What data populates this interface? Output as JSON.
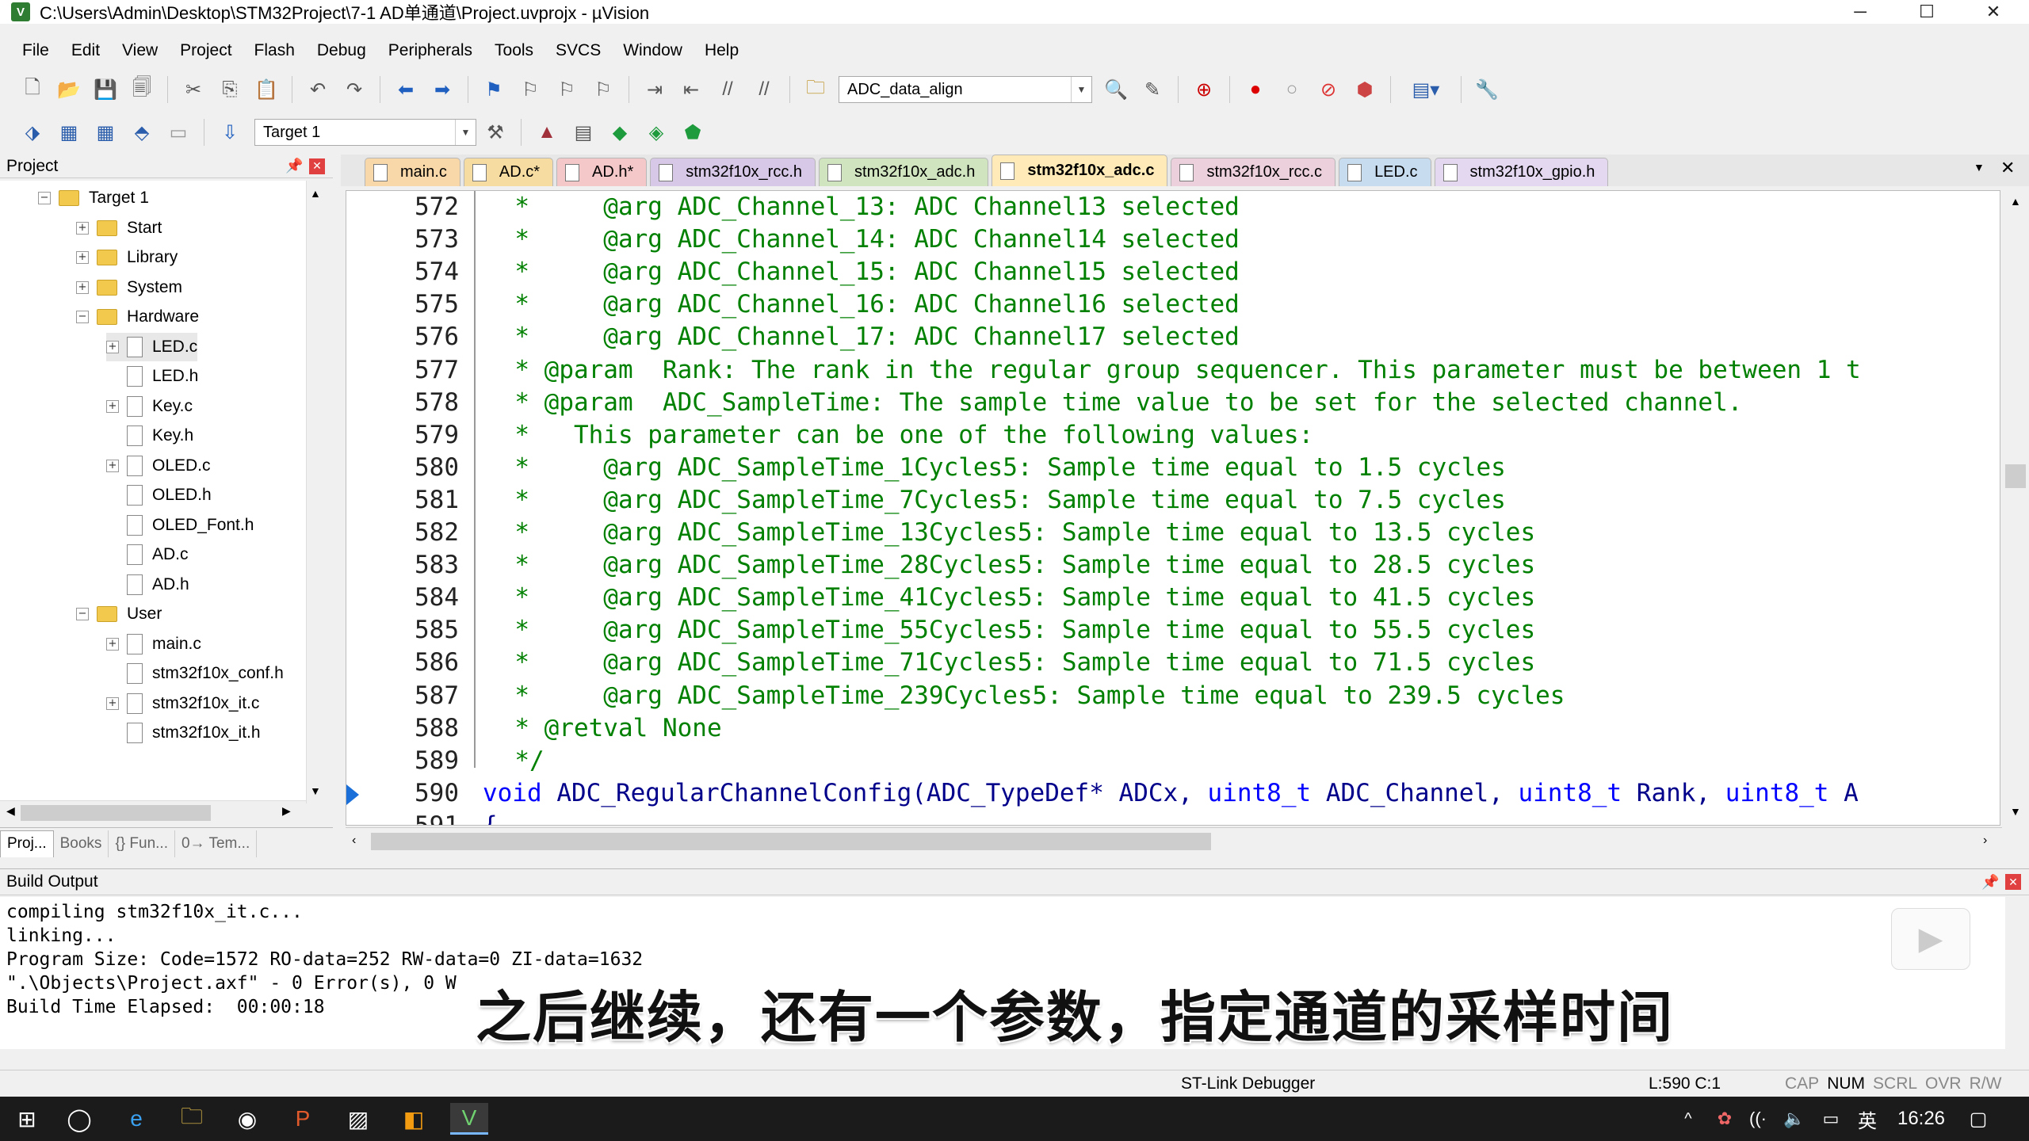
{
  "window": {
    "title": "C:\\Users\\Admin\\Desktop\\STM32Project\\7-1 AD单通道\\Project.uvprojx - µVision",
    "minimize": "─",
    "maximize": "☐",
    "close": "✕"
  },
  "menu": [
    "File",
    "Edit",
    "View",
    "Project",
    "Flash",
    "Debug",
    "Peripherals",
    "Tools",
    "SVCS",
    "Window",
    "Help"
  ],
  "toolbar": {
    "find_combo": "ADC_data_align",
    "target_combo": "Target 1"
  },
  "project_panel": {
    "title": "Project",
    "tree": [
      {
        "label": "Target 1",
        "type": "folder",
        "indent": 0,
        "expander": "−"
      },
      {
        "label": "Start",
        "type": "folder",
        "indent": 1,
        "expander": "+"
      },
      {
        "label": "Library",
        "type": "folder",
        "indent": 1,
        "expander": "+"
      },
      {
        "label": "System",
        "type": "folder",
        "indent": 1,
        "expander": "+"
      },
      {
        "label": "Hardware",
        "type": "folder",
        "indent": 1,
        "expander": "−"
      },
      {
        "label": "LED.c",
        "type": "file",
        "indent": 2,
        "expander": "+"
      },
      {
        "label": "LED.h",
        "type": "file",
        "indent": 2,
        "expander": ""
      },
      {
        "label": "Key.c",
        "type": "file",
        "indent": 2,
        "expander": "+"
      },
      {
        "label": "Key.h",
        "type": "file",
        "indent": 2,
        "expander": ""
      },
      {
        "label": "OLED.c",
        "type": "file",
        "indent": 2,
        "expander": "+"
      },
      {
        "label": "OLED.h",
        "type": "file",
        "indent": 2,
        "expander": ""
      },
      {
        "label": "OLED_Font.h",
        "type": "file",
        "indent": 2,
        "expander": ""
      },
      {
        "label": "AD.c",
        "type": "file",
        "indent": 2,
        "expander": ""
      },
      {
        "label": "AD.h",
        "type": "file",
        "indent": 2,
        "expander": ""
      },
      {
        "label": "User",
        "type": "folder",
        "indent": 1,
        "expander": "−"
      },
      {
        "label": "main.c",
        "type": "file",
        "indent": 2,
        "expander": "+"
      },
      {
        "label": "stm32f10x_conf.h",
        "type": "file",
        "indent": 2,
        "expander": ""
      },
      {
        "label": "stm32f10x_it.c",
        "type": "file",
        "indent": 2,
        "expander": "+"
      },
      {
        "label": "stm32f10x_it.h",
        "type": "file",
        "indent": 2,
        "expander": ""
      }
    ],
    "tabs": [
      "Proj...",
      "Books",
      "{} Fun...",
      "0→ Tem..."
    ]
  },
  "editor_tabs": [
    {
      "label": "main.c",
      "active": false,
      "color": "#f8d8a8"
    },
    {
      "label": "AD.c*",
      "active": false,
      "color": "#f6dca0"
    },
    {
      "label": "AD.h*",
      "active": false,
      "color": "#f4c8c8"
    },
    {
      "label": "stm32f10x_rcc.h",
      "active": false,
      "color": "#d8c8e8"
    },
    {
      "label": "stm32f10x_adc.h",
      "active": false,
      "color": "#d0e4c0"
    },
    {
      "label": "stm32f10x_adc.c",
      "active": true,
      "color": "#ffeab8"
    },
    {
      "label": "stm32f10x_rcc.c",
      "active": false,
      "color": "#ecd0dc"
    },
    {
      "label": "LED.c",
      "active": false,
      "color": "#c8dcf0"
    },
    {
      "label": "stm32f10x_gpio.h",
      "active": false,
      "color": "#e4d8f0"
    }
  ],
  "code": [
    {
      "n": "572",
      "t": "  *     @arg ADC_Channel_13: ADC Channel13 selected",
      "kind": "comment"
    },
    {
      "n": "573",
      "t": "  *     @arg ADC_Channel_14: ADC Channel14 selected",
      "kind": "comment"
    },
    {
      "n": "574",
      "t": "  *     @arg ADC_Channel_15: ADC Channel15 selected",
      "kind": "comment"
    },
    {
      "n": "575",
      "t": "  *     @arg ADC_Channel_16: ADC Channel16 selected",
      "kind": "comment"
    },
    {
      "n": "576",
      "t": "  *     @arg ADC_Channel_17: ADC Channel17 selected",
      "kind": "comment"
    },
    {
      "n": "577",
      "t": "  * @param  Rank: The rank in the regular group sequencer. This parameter must be between 1 t",
      "kind": "comment"
    },
    {
      "n": "578",
      "t": "  * @param  ADC_SampleTime: The sample time value to be set for the selected channel.",
      "kind": "comment"
    },
    {
      "n": "579",
      "t": "  *   This parameter can be one of the following values:",
      "kind": "comment"
    },
    {
      "n": "580",
      "t": "  *     @arg ADC_SampleTime_1Cycles5: Sample time equal to 1.5 cycles",
      "kind": "comment"
    },
    {
      "n": "581",
      "t": "  *     @arg ADC_SampleTime_7Cycles5: Sample time equal to 7.5 cycles",
      "kind": "comment"
    },
    {
      "n": "582",
      "t": "  *     @arg ADC_SampleTime_13Cycles5: Sample time equal to 13.5 cycles",
      "kind": "comment"
    },
    {
      "n": "583",
      "t": "  *     @arg ADC_SampleTime_28Cycles5: Sample time equal to 28.5 cycles",
      "kind": "comment"
    },
    {
      "n": "584",
      "t": "  *     @arg ADC_SampleTime_41Cycles5: Sample time equal to 41.5 cycles",
      "kind": "comment"
    },
    {
      "n": "585",
      "t": "  *     @arg ADC_SampleTime_55Cycles5: Sample time equal to 55.5 cycles",
      "kind": "comment"
    },
    {
      "n": "586",
      "t": "  *     @arg ADC_SampleTime_71Cycles5: Sample time equal to 71.5 cycles",
      "kind": "comment"
    },
    {
      "n": "587",
      "t": "  *     @arg ADC_SampleTime_239Cycles5: Sample time equal to 239.5 cycles",
      "kind": "comment"
    },
    {
      "n": "588",
      "t": "  * @retval None",
      "kind": "comment"
    },
    {
      "n": "589",
      "t": "  */",
      "kind": "comment"
    },
    {
      "n": "590",
      "t": "void ADC_RegularChannelConfig(ADC_TypeDef* ADCx, uint8_t ADC_Channel, uint8_t Rank, uint8_t A",
      "kind": "code"
    },
    {
      "n": "591",
      "t": "{",
      "kind": "code"
    }
  ],
  "build_output": {
    "title": "Build Output",
    "lines": [
      "compiling stm32f10x_it.c...",
      "linking...",
      "Program Size: Code=1572 RO-data=252 RW-data=0 ZI-data=1632",
      "\".\\Objects\\Project.axf\" - 0 Error(s), 0 W",
      "Build Time Elapsed:  00:00:18"
    ]
  },
  "subtitle": "之后继续，还有一个参数，指定通道的采样时间",
  "status": {
    "debugger": "ST-Link Debugger",
    "position": "L:590 C:1",
    "indicators": [
      "CAP",
      "NUM",
      "SCRL",
      "OVR",
      "R/W"
    ]
  },
  "taskbar": {
    "time": "16:26",
    "ime": "英"
  },
  "colors": {
    "comment": "#008000",
    "code": "#00008b",
    "keyword": "#0000ff",
    "active_tab": "#ffeab8"
  }
}
